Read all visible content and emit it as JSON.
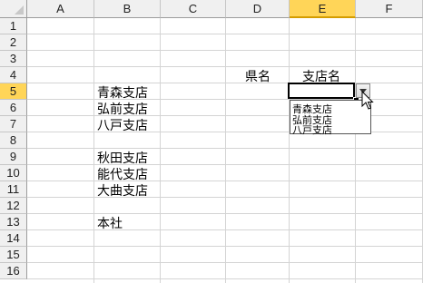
{
  "columns": [
    "A",
    "B",
    "C",
    "D",
    "E",
    "F"
  ],
  "rows": [
    "1",
    "2",
    "3",
    "4",
    "5",
    "6",
    "7",
    "8",
    "9",
    "10",
    "11",
    "12",
    "13",
    "14",
    "15",
    "16"
  ],
  "selected_column": "E",
  "selected_row": "5",
  "cells": {
    "D4": "県名",
    "E4": "支店名",
    "B5": "青森支店",
    "B6": "弘前支店",
    "B7": "八戸支店",
    "B9": "秋田支店",
    "B10": "能代支店",
    "B11": "大曲支店",
    "B13": "本社"
  },
  "active_cell": "E5",
  "dropdown": {
    "options": [
      "青森支店",
      "弘前支店",
      "八戸支店"
    ]
  },
  "colors": {
    "header_bg": "#f0f0f0",
    "selected_header_bg": "#ffd558",
    "gridline": "#d4d4d4"
  }
}
